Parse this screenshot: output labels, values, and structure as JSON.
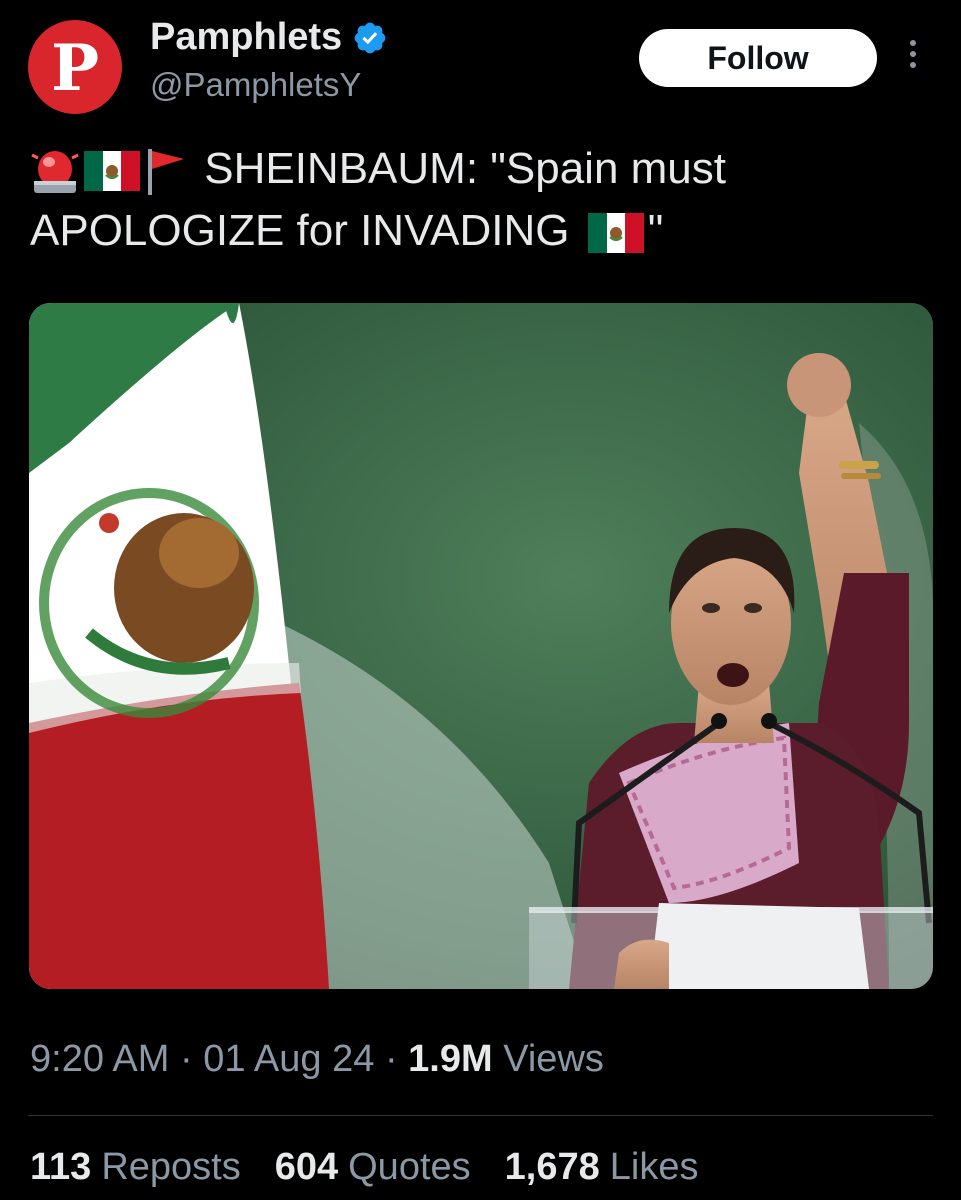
{
  "account": {
    "avatar_letter": "P",
    "avatar_color": "#d9262c",
    "name": "Pamphlets",
    "verified_icon": "verified-badge-icon",
    "handle": "@PamphletsY"
  },
  "actions": {
    "follow_label": "Follow",
    "more_icon": "more-vertical-icon"
  },
  "tweet": {
    "emoji_prefix": [
      "police-light-emoji",
      "mexico-flag-emoji",
      "red-flag-emoji"
    ],
    "text_line1": "SHEINBAUM: \"Spain must",
    "text_line2_start": "APOLOGIZE for INVADING",
    "text_line2_end": "\"",
    "inline_emoji": "mexico-flag-emoji"
  },
  "media": {
    "kind": "photo",
    "subject": "speaker at podium with raised fist beside Mexican flag"
  },
  "meta": {
    "time": "9:20 AM",
    "separator": "·",
    "date": "01 Aug 24",
    "views_count": "1.9M",
    "views_label": "Views"
  },
  "stats": {
    "reposts_count": "113",
    "reposts_label": "Reposts",
    "quotes_count": "604",
    "quotes_label": "Quotes",
    "likes_count": "1,678",
    "likes_label": "Likes"
  },
  "colors": {
    "background": "#000000",
    "text": "#e7e9ea",
    "muted": "#8b98a5",
    "verified": "#1d9bf0"
  }
}
